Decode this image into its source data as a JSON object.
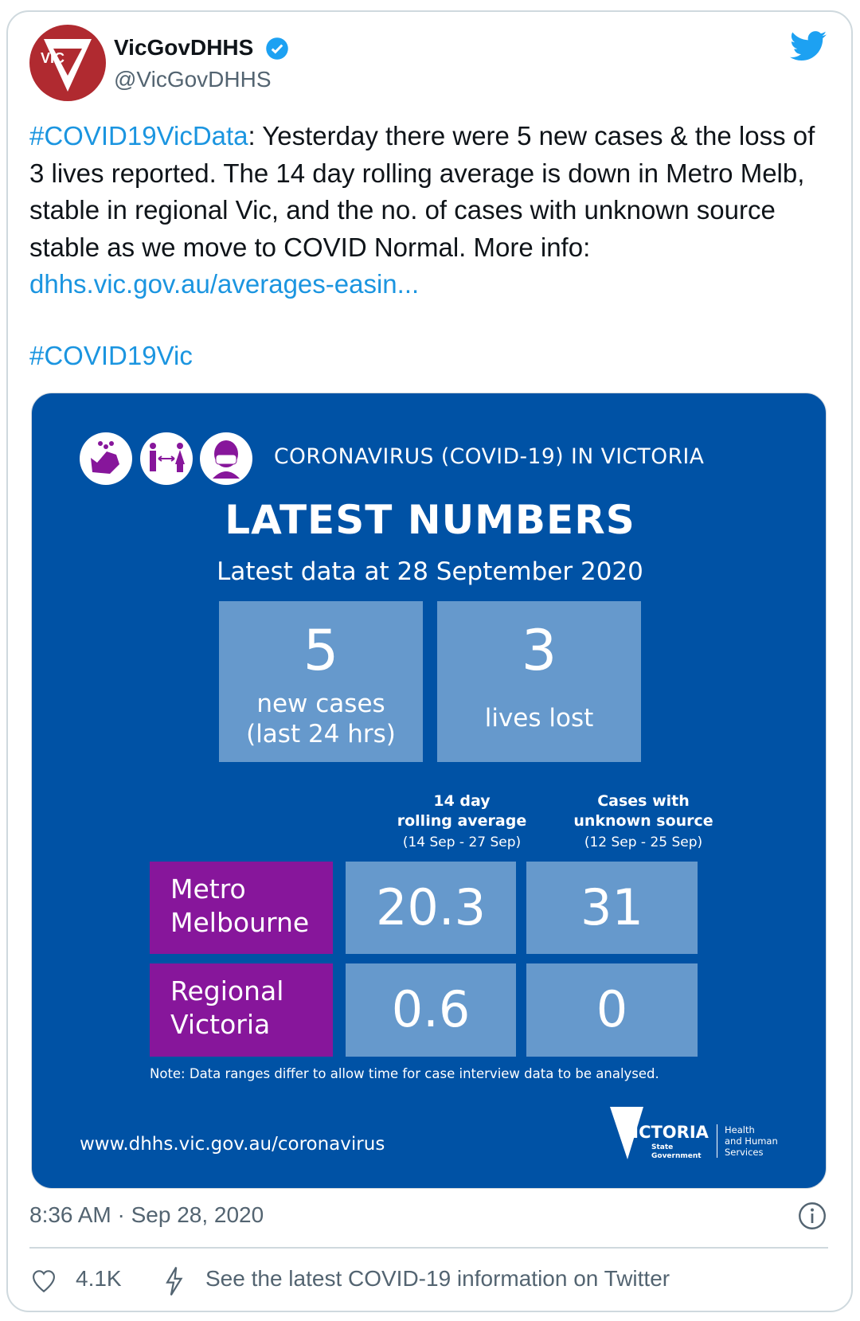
{
  "tweet": {
    "author_name": "VicGovDHHS",
    "handle": "@VicGovDHHS",
    "avatar_text": "VIC",
    "hashtag1": "#COVID19VicData",
    "body": ": Yesterday there were 5 new cases & the loss of 3 lives reported. The 14 day rolling average is down in Metro Melb, stable in regional Vic, and the no. of cases with unknown source stable as we move to COVID Normal. More info: ",
    "link": "dhhs.vic.gov.au/averages-easin...",
    "hashtag2": "#COVID19Vic",
    "timestamp": "8:36 AM · Sep 28, 2020",
    "likes": "4.1K",
    "info_link": "See the latest COVID-19 information on Twitter"
  },
  "infographic": {
    "header": "CORONAVIRUS (COVID-19) IN VICTORIA",
    "title": "LATEST NUMBERS",
    "subtitle": "Latest data at 28 September 2020",
    "new_cases": {
      "value": "5",
      "label1": "new cases",
      "label2": "(last 24 hrs)"
    },
    "lives_lost": {
      "value": "3",
      "label": "lives lost"
    },
    "col1": {
      "l1": "14 day",
      "l2": "rolling average",
      "l3": "(14 Sep - 27 Sep)"
    },
    "col2": {
      "l1": "Cases with",
      "l2": "unknown source",
      "l3": "(12 Sep - 25 Sep)"
    },
    "rows": [
      {
        "l1": "Metro",
        "l2": "Melbourne",
        "avg": "20.3",
        "unknown": "31"
      },
      {
        "l1": "Regional",
        "l2": "Victoria",
        "avg": "0.6",
        "unknown": "0"
      }
    ],
    "note": "Note: Data ranges differ to allow time for case interview data to be analysed.",
    "url": "www.dhhs.vic.gov.au/coronavirus",
    "logo": {
      "word": "VICTORIA",
      "sub1": "State",
      "sub2": "Government",
      "dept1": "Health",
      "dept2": "and Human",
      "dept3": "Services"
    }
  },
  "colors": {
    "brand_blue": "#0052a5",
    "box_blue": "#6699cc",
    "purple": "#87169b",
    "twitter_blue": "#1da1f2"
  }
}
